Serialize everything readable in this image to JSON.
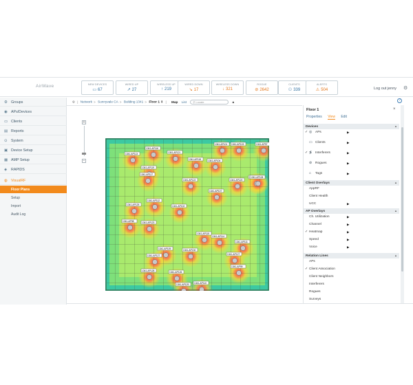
{
  "brand": "AirWave",
  "stats": [
    {
      "label": "NEW DEVICES",
      "value": "67",
      "icon": "devices-icon",
      "color": "#2f6f9f"
    },
    {
      "label": "WIRED UP",
      "value": "27",
      "icon": "arrow-up-icon",
      "color": "#2f6f9f"
    },
    {
      "label": "WIRELESS UP",
      "value": "219",
      "icon": "arrow-up-icon",
      "color": "#2f6f9f"
    },
    {
      "label": "WIRED DOWN",
      "value": "17",
      "icon": "arrow-down-icon",
      "color": "#e3761a"
    },
    {
      "label": "WIRELESS DOWN",
      "value": "321",
      "icon": "arrow-down-icon",
      "color": "#e3761a"
    },
    {
      "label": "ROGUE",
      "value": "2642",
      "icon": "rogue-icon",
      "color": "#e3761a"
    },
    {
      "label": "CLIENTS",
      "value": "339",
      "icon": "user-icon",
      "color": "#2f6f9f"
    },
    {
      "label": "ALERTS",
      "value": "504",
      "icon": "alert-icon",
      "color": "#e3761a"
    }
  ],
  "user": {
    "logout": "Log out jenny"
  },
  "sidebar": {
    "items": [
      {
        "label": "Groups",
        "icon": "groups-icon"
      },
      {
        "label": "APs/Devices",
        "icon": "devices-icon"
      },
      {
        "label": "Clients",
        "icon": "clients-icon"
      },
      {
        "label": "Reports",
        "icon": "reports-icon"
      },
      {
        "label": "System",
        "icon": "system-icon"
      },
      {
        "label": "Device Setup",
        "icon": "device-setup-icon"
      },
      {
        "label": "AMP Setup",
        "icon": "amp-setup-icon"
      },
      {
        "label": "RAPIDS",
        "icon": "rapids-icon"
      },
      {
        "label": "VisualRF",
        "icon": "visualrf-icon"
      }
    ],
    "subitems": [
      "Floor Plans",
      "Setup",
      "Import",
      "Audit Log"
    ]
  },
  "breadcrumb": {
    "parts": [
      "Network",
      "Sunnyvale CA",
      "Building 1341"
    ],
    "current": "Floor 1",
    "view_map": "Map",
    "view_list": "List",
    "locate_placeholder": "Locate"
  },
  "panel": {
    "title": "Floor 1",
    "tabs": [
      "Properties",
      "View",
      "Edit"
    ],
    "sections": [
      {
        "title": "Devices",
        "rows": [
          {
            "label": "APs",
            "checked": true,
            "icon": "ap-icon",
            "arrow": true
          },
          {
            "label": "Clients",
            "checked": false,
            "icon": "laptop-icon",
            "arrow": true
          },
          {
            "label": "Interferers",
            "checked": true,
            "icon": "interferer-icon",
            "arrow": true
          },
          {
            "label": "Rogues",
            "checked": false,
            "icon": "rogue-icon",
            "arrow": true
          },
          {
            "label": "Tags",
            "checked": false,
            "icon": "tag-icon",
            "arrow": true
          }
        ]
      },
      {
        "title": "Client Overlays",
        "rows": [
          {
            "label": "AppRF",
            "checked": false,
            "arrow": false
          },
          {
            "label": "Client Health",
            "checked": false,
            "arrow": false
          },
          {
            "label": "UCC",
            "checked": false,
            "arrow": true
          }
        ]
      },
      {
        "title": "AP Overlays",
        "rows": [
          {
            "label": "Ch. Utilization",
            "checked": false,
            "arrow": true
          },
          {
            "label": "Channel",
            "checked": false,
            "arrow": true
          },
          {
            "label": "Heatmap",
            "checked": true,
            "arrow": true
          },
          {
            "label": "Speed",
            "checked": false,
            "arrow": true
          },
          {
            "label": "Voice",
            "checked": false,
            "arrow": true
          }
        ]
      },
      {
        "title": "Relation Lines",
        "rows": [
          {
            "label": "APs",
            "checked": false,
            "arrow": false
          },
          {
            "label": "Client Association",
            "checked": true,
            "arrow": false
          },
          {
            "label": "Client Neighbors",
            "checked": false,
            "arrow": false
          },
          {
            "label": "Interferers",
            "checked": false,
            "arrow": false
          },
          {
            "label": "Rogues",
            "checked": false,
            "arrow": false
          },
          {
            "label": "Surveys",
            "checked": false,
            "arrow": false
          }
        ]
      }
    ]
  },
  "aps": [
    "1341-AP116",
    "1341-AP121",
    "1341-AP101",
    "1341-AP103",
    "1341-AP97",
    "1341-AP113",
    "1341-AP118",
    "1341-AP119",
    "1341-AP104",
    "1341-AP88",
    "1341-AP117",
    "1341-AP122",
    "1341-AP107",
    "1341-AP108",
    "1341-AP120",
    "1341-AP98",
    "1341-AP123",
    "1341-AP102",
    "1341-AP112",
    "1341-AP125",
    "1341-AP114",
    "1341-AP109",
    "1341-AP127",
    "1341-AP127",
    "1341-AP130",
    "1341-AP111",
    "1341-AP115",
    "1341-AP126",
    "1341-AP128",
    "1341-AP99",
    "1341-AP110",
    "1341-AP129"
  ]
}
